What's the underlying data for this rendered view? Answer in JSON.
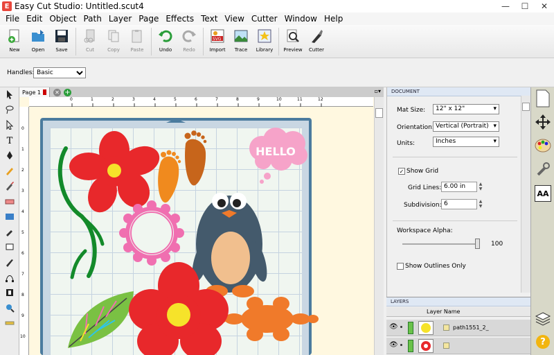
{
  "window": {
    "title": "Easy Cut Studio: Untitled.scut4"
  },
  "menu": [
    "File",
    "Edit",
    "Object",
    "Path",
    "Layer",
    "Page",
    "Effects",
    "Text",
    "View",
    "Cutter",
    "Window",
    "Help"
  ],
  "toolbar": {
    "new": "New",
    "open": "Open",
    "save": "Save",
    "cut": "Cut",
    "copy": "Copy",
    "paste": "Paste",
    "undo": "Undo",
    "redo": "Redo",
    "import": "Import",
    "trace": "Trace",
    "library": "Library",
    "preview": "Preview",
    "cutter": "Cutter"
  },
  "handles": {
    "label": "Handles:",
    "value": "Basic"
  },
  "page_tab": {
    "label": "Page 1"
  },
  "ruler": {
    "h": [
      "0",
      "1",
      "2",
      "3",
      "4",
      "5",
      "6",
      "7",
      "8",
      "9",
      "10",
      "11",
      "12"
    ],
    "v": [
      "0",
      "1",
      "2",
      "3",
      "4",
      "5",
      "6",
      "7",
      "8",
      "9",
      "10"
    ]
  },
  "canvas": {
    "hello_text": "HELLO"
  },
  "document": {
    "header": "DOCUMENT",
    "mat_size_label": "Mat Size:",
    "mat_size": "12\" x 12\"",
    "orientation_label": "Orientation:",
    "orientation": "Vertical (Portrait)",
    "units_label": "Units:",
    "units": "Inches",
    "show_grid_label": "Show Grid",
    "grid_lines_label": "Grid Lines:",
    "grid_lines": "6.00 in",
    "subdivision_label": "Subdivision:",
    "subdivision": "6",
    "workspace_alpha_label": "Workspace Alpha:",
    "workspace_alpha": "100",
    "workspace_alpha_level": 1.0,
    "show_outlines_label": "Show Outlines Only"
  },
  "layers": {
    "header": "LAYERS",
    "column": "Layer Name",
    "rows": [
      {
        "name": "path1551_2_"
      },
      {
        "name": ""
      }
    ]
  },
  "right_strip": {
    "text_icon": "AA"
  },
  "colors": {
    "flower_red": "#e8282b",
    "flower_center": "#f6e32a",
    "penguin": "#445a6c",
    "orange": "#f07a2a",
    "pink": "#f06fb0",
    "green": "#138a2a",
    "leaf": "#7ac143"
  }
}
